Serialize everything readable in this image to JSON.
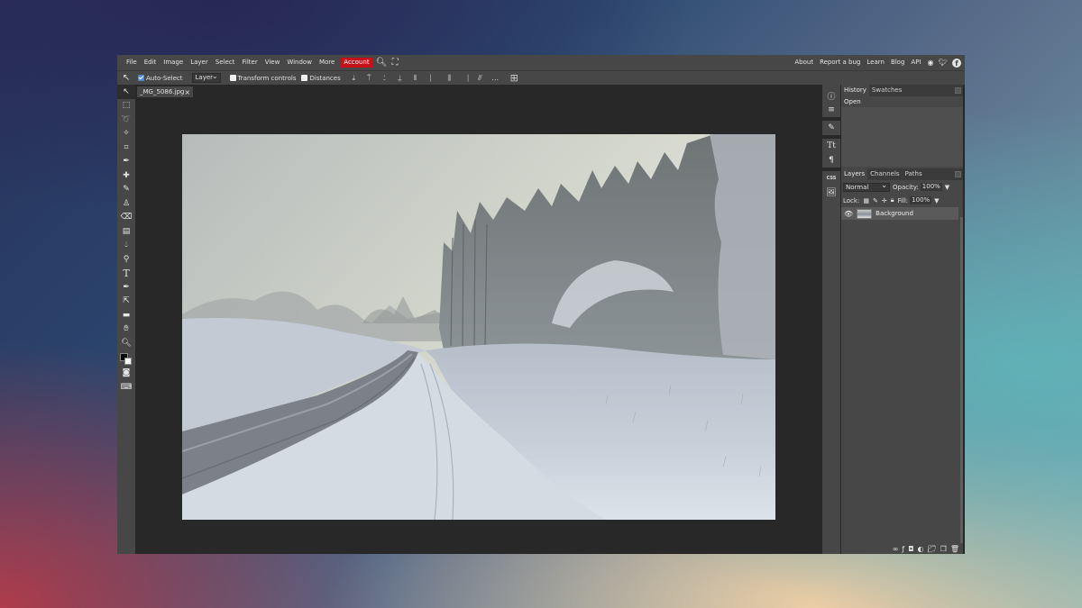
{
  "menu": {
    "items": [
      "File",
      "Edit",
      "Image",
      "Layer",
      "Select",
      "Filter",
      "View",
      "Window",
      "More"
    ],
    "account": "Account",
    "right_links": [
      "About",
      "Report a bug",
      "Learn",
      "Blog",
      "API"
    ],
    "icons": [
      "search-icon",
      "fullscreen-icon",
      "reddit-icon",
      "twitter-icon",
      "facebook-icon"
    ]
  },
  "options": {
    "auto_select": "Auto-Select",
    "auto_select_checked": true,
    "select_value": "Layer",
    "transform_controls": "Transform controls",
    "transform_checked": false,
    "distances": "Distances",
    "distances_checked": false,
    "more": "..."
  },
  "document": {
    "tab_name": "_MG_5086.jpg",
    "close_glyph": "×"
  },
  "panels": {
    "history_tab": "History",
    "swatches_tab": "Swatches",
    "history_items": [
      "Open"
    ],
    "layers_tab": "Layers",
    "channels_tab": "Channels",
    "paths_tab": "Paths",
    "blend_mode": "Normal",
    "opacity_label": "Opacity:",
    "opacity_value": "100%",
    "lock_label": "Lock:",
    "fill_label": "Fill:",
    "fill_value": "100%",
    "layers": [
      {
        "name": "Background",
        "visible": true
      }
    ]
  },
  "colors": {
    "foreground": "#000000",
    "background": "#ffffff",
    "account_accent": "#c8101a"
  }
}
